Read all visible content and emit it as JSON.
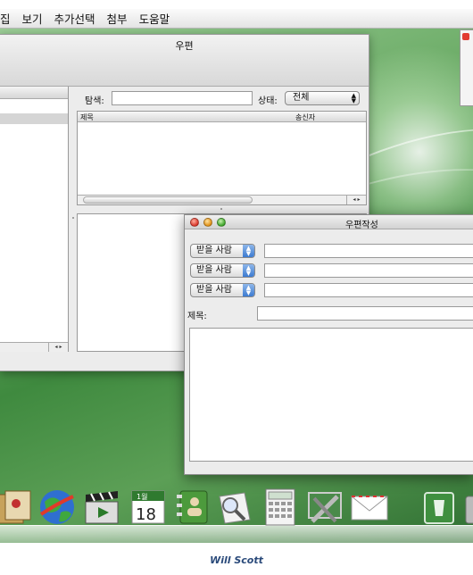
{
  "menu_bar": {
    "items": [
      "집",
      "보기",
      "추가선택",
      "첨부",
      "도움말"
    ]
  },
  "mail_window": {
    "title": "우편",
    "search_label": "탐색:",
    "search_value": "",
    "status_label": "상태:",
    "status_value": "전체",
    "list_columns": [
      "제목",
      "송신자"
    ]
  },
  "compose_window": {
    "title": "우편작성",
    "recipient_popups": [
      "받을 사람",
      "받을 사람",
      "받을 사람"
    ],
    "subject_label": "제목:",
    "subject_value": "",
    "body": ""
  },
  "dock": {
    "icons": [
      "photos-icon",
      "browser-globe-icon",
      "video-clapper-icon",
      "calendar-icon",
      "address-book-icon",
      "preview-icon",
      "calculator-icon",
      "system-tools-icon",
      "mail-envelope-icon",
      "trash-icon"
    ],
    "calendar_month": "1월",
    "calendar_day": "18"
  },
  "caption": "Will Scott"
}
